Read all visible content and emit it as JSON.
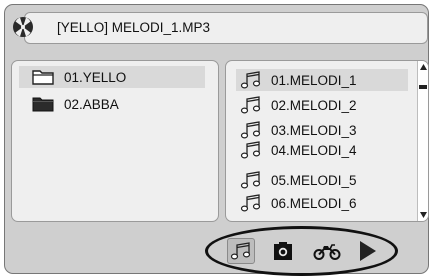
{
  "header": {
    "title": "[YELLO] MELODI_1.MP3",
    "icon": "disc-icon"
  },
  "folders": [
    {
      "label": "01.YELLO",
      "icon": "folder-open-icon",
      "selected": true
    },
    {
      "label": "02.ABBA",
      "icon": "folder-icon",
      "selected": false
    }
  ],
  "files": [
    {
      "label": "01.MELODI_1",
      "icon": "music-note-icon",
      "selected": true
    },
    {
      "label": "02.MELODI_2",
      "icon": "music-note-icon",
      "selected": false
    },
    {
      "label": "03.MELODI_3",
      "icon": "music-note-icon",
      "selected": false
    },
    {
      "label": "04.MELODI_4",
      "icon": "music-note-icon",
      "selected": false
    },
    {
      "label": "05.MELODI_5",
      "icon": "music-note-icon",
      "selected": false
    },
    {
      "label": "06.MELODI_6",
      "icon": "music-note-icon",
      "selected": false
    }
  ],
  "tabs": [
    {
      "name": "music",
      "icon": "music-note-icon",
      "active": true
    },
    {
      "name": "photo",
      "icon": "camera-icon",
      "active": false
    },
    {
      "name": "video",
      "icon": "motorcycle-icon",
      "active": false
    },
    {
      "name": "play",
      "icon": "play-icon",
      "active": false
    }
  ],
  "colors": {
    "background": "#cfcfcf",
    "panel": "#efefef",
    "selection": "#d9d9d9",
    "highlight_ring": "#111111"
  }
}
